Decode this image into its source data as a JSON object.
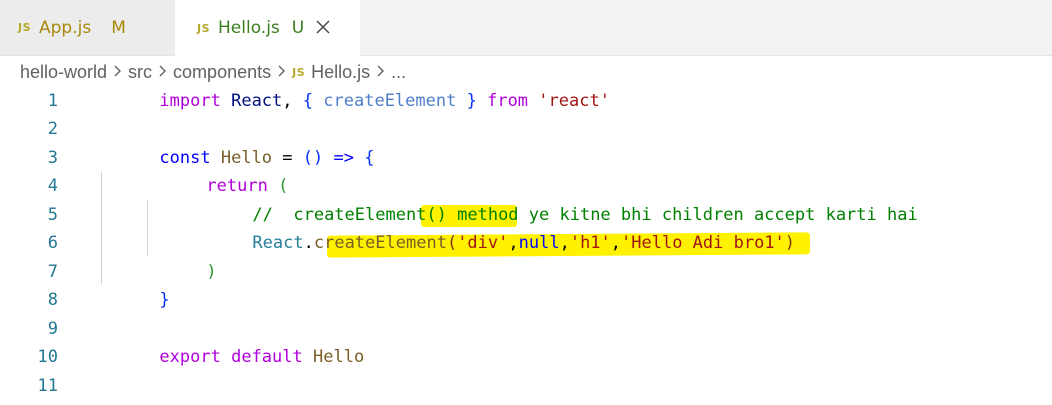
{
  "tabs": [
    {
      "icon": "JS",
      "label": "App.js",
      "status": "M",
      "active": false
    },
    {
      "icon": "JS",
      "label": "Hello.js",
      "status": "U",
      "active": true
    }
  ],
  "breadcrumb": {
    "items": [
      "hello-world",
      "src",
      "components"
    ],
    "file_icon": "JS",
    "file": "Hello.js",
    "more": "..."
  },
  "editor": {
    "line_numbers": [
      "1",
      "2",
      "3",
      "4",
      "5",
      "6",
      "7",
      "8",
      "9",
      "10",
      "11"
    ],
    "lines": {
      "l1": {
        "import": "import",
        "react_id": "React",
        "comma": ",",
        "lbrace": "{",
        "named": "createElement",
        "rbrace": "}",
        "from": "from",
        "module": "'react'"
      },
      "l3": {
        "const": "const",
        "name": "Hello",
        "eq": "=",
        "parens": "()",
        "arrow": "=>",
        "lbrace": "{"
      },
      "l4": {
        "return": "return",
        "lparen": "("
      },
      "l5": {
        "comment_a": "//  createElement() ",
        "comment_b": "method y",
        "comment_c": "e kitne bhi children accept karti hai"
      },
      "l6": {
        "obj": "React",
        "dot": ".",
        "fn_a": "create",
        "fn_b": "Element",
        "lparen": "(",
        "s1": "'div'",
        "c1": ",",
        "null": "null",
        "c2": ",",
        "s2": "'h1'",
        "c3": ",",
        "s3": "'Hello Adi bro1'",
        "rparen": ")"
      },
      "l7": {
        "rparen": ")"
      },
      "l8": {
        "rbrace": "}"
      },
      "l10": {
        "export": "export",
        "default": "default",
        "name": "Hello"
      }
    }
  },
  "colors": {
    "highlight": "#fff200",
    "line_number": "#237893",
    "keyword": "#0000ff",
    "control_keyword": "#af00db",
    "string": "#a31515",
    "comment": "#008000"
  }
}
